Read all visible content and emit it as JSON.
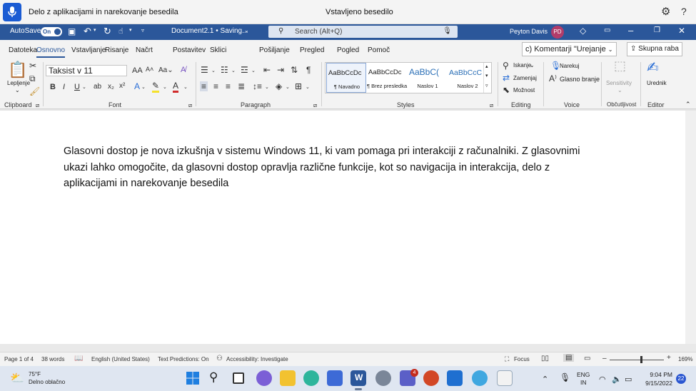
{
  "voice_access": {
    "status": "Delo z aplikacijami in narekovanje besedila",
    "center_text": "Vstavljeno besedilo"
  },
  "titlebar": {
    "autosave_label": "AutoSave",
    "autosave_state": "On",
    "doc_name": "Document2.1 • Saving...",
    "search_placeholder": "Search (Alt+Q)",
    "user_name": "Peyton Davis",
    "user_initials": "PD"
  },
  "tabs": [
    "Datoteka",
    "Osnovno",
    "Vstavljanje",
    "Risanje",
    "Načrt",
    "Postavitev",
    "Sklici",
    "Pošiljanje",
    "Pregled",
    "Pogled",
    "Pomoč"
  ],
  "comments_label": "c) Komentarji \"Urejanje",
  "share_label": "Skupna raba",
  "ribbon": {
    "clipboard": {
      "paste": "Lepljenje",
      "label": "Clipboard"
    },
    "font": {
      "name": "Taksist v 11",
      "label": "Font"
    },
    "paragraph": {
      "label": "Paragraph"
    },
    "styles": {
      "label": "Styles",
      "items": [
        {
          "preview": "AaBbCcDc",
          "name": "¶ Navadno"
        },
        {
          "preview": "AaBbCcDc",
          "name": "¶ Brez presledka"
        },
        {
          "preview": "AaBbC(",
          "name": "Naslov 1"
        },
        {
          "preview": "AaBbCcC",
          "name": "Naslov 2"
        }
      ]
    },
    "editing": {
      "find": "Iskanje",
      "replace": "Zamenjaj",
      "select": "Možnost",
      "label": "Editing"
    },
    "voice": {
      "dictate": "Narekuj",
      "read_aloud": "Glasno branje",
      "label": "Voice"
    },
    "sensitivity": {
      "button": "Sensitivity",
      "label": "Občutljivost"
    },
    "editor": {
      "button": "Urednik",
      "label": "Editor"
    }
  },
  "document": {
    "text": "Glasovni dostop je nova izkušnja v sistemu Windows 11, ki vam pomaga pri interakciji z računalniki. Z glasovnimi ukazi lahko omogočite, da glasovni dostop opravlja različne funkcije, kot so navigacija in interakcija, delo z aplikacijami in narekovanje besedila"
  },
  "statusbar": {
    "page": "Page 1 of 4",
    "words": "38 words",
    "language": "English (United States)",
    "predictions": "Text Predictions: On",
    "accessibility": "Accessibility: Investigate",
    "focus": "Focus",
    "zoom": "169%",
    "zoom_level": 169
  },
  "taskbar": {
    "temperature": "75°F",
    "weather": "Delno oblačno",
    "lang_top": "ENG",
    "lang_bottom": "IN",
    "time": "9:04 PM",
    "date": "9/15/2022",
    "notifications": "22",
    "teams_badge": "4"
  },
  "colors": {
    "word_blue": "#2b579a",
    "voice_blue": "#1a5bd3",
    "taskbar": "#dfe6f1"
  }
}
